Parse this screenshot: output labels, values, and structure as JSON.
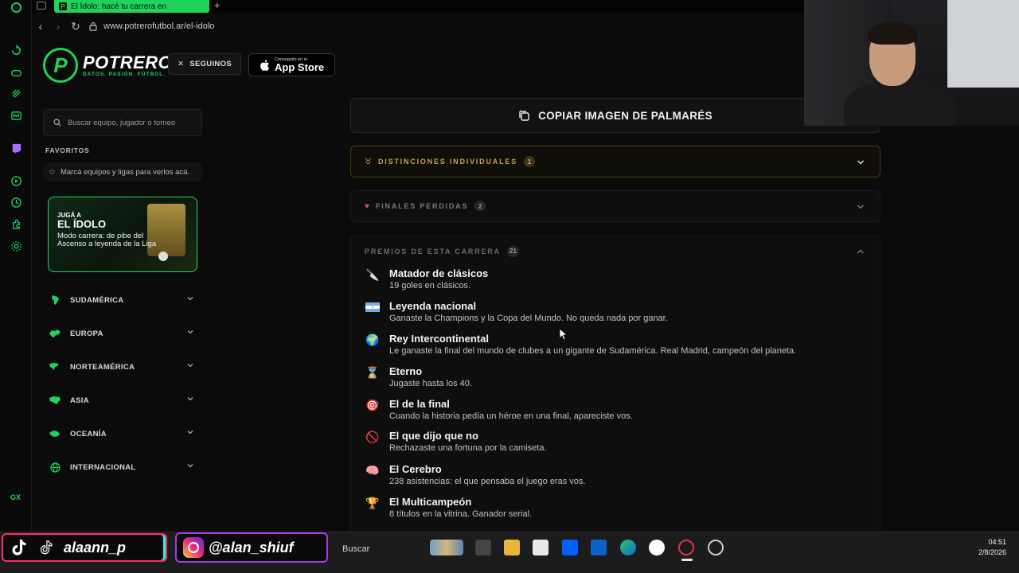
{
  "browser": {
    "tab_title": "El Ídolo: hacé tu carrera en",
    "tab_favicon": "P",
    "url": "www.potrerofutbol.ar/el-idolo",
    "new_tab_symbol": "+",
    "gx_label": "GX"
  },
  "header": {
    "logo_letter": "P",
    "logo_name": "POTRERO",
    "logo_tagline": "DATOS. PASIÓN. FÚTBOL.",
    "follow_label": "SEGUINOS",
    "appstore_line1": "Conseguilo en el",
    "appstore_line2": "App Store"
  },
  "sidebar": {
    "search_placeholder": "Buscar equipo, jugador o torneo",
    "favorites_title": "FAVORITOS",
    "favorites_empty": "Marcá equipos y ligas para verlos acá.",
    "promo": {
      "kicker": "JUGÁ A",
      "title": "EL ÍDOLO",
      "text": "Modo carrera: de pibe del Ascenso a leyenda de la Liga"
    },
    "regions": [
      {
        "label": "SUDAMÉRICA",
        "icon": "south-america-icon"
      },
      {
        "label": "EUROPA",
        "icon": "europe-icon"
      },
      {
        "label": "NORTEAMÉRICA",
        "icon": "north-america-icon"
      },
      {
        "label": "ASIA",
        "icon": "asia-icon"
      },
      {
        "label": "OCEANÍA",
        "icon": "oceania-icon"
      },
      {
        "label": "INTERNACIONAL",
        "icon": "globe-icon"
      }
    ]
  },
  "main": {
    "copy_button": "COPIAR IMAGEN DE PALMARÉS",
    "sections": {
      "distinciones": {
        "label": "DISTINCIONES INDIVIDUALES",
        "count": "1",
        "color": "#c9a24a"
      },
      "finales": {
        "label": "FINALES PERDIDAS",
        "count": "2"
      },
      "premios": {
        "label": "PREMIOS DE ESTA CARRERA",
        "count": "21"
      }
    },
    "awards": [
      {
        "icon": "knife-icon",
        "glyph": "🔪",
        "name": "Matador de clásicos",
        "desc": "19 goles en clásicos."
      },
      {
        "icon": "argentina-flag-icon",
        "glyph": "",
        "name": "Leyenda nacional",
        "desc": "Ganaste la Champions y la Copa del Mundo. No queda nada por ganar."
      },
      {
        "icon": "globe-icon",
        "glyph": "🌍",
        "name": "Rey Intercontinental",
        "desc": "Le ganaste la final del mundo de clubes a un gigante de Sudamérica. Real Madrid, campeón del planeta."
      },
      {
        "icon": "hourglass-icon",
        "glyph": "⌛",
        "name": "Eterno",
        "desc": "Jugaste hasta los 40."
      },
      {
        "icon": "target-icon",
        "glyph": "🎯",
        "name": "El de la final",
        "desc": "Cuando la historia pedía un héroe en una final, apareciste vos."
      },
      {
        "icon": "prohibited-icon",
        "glyph": "🚫",
        "name": "El que dijo que no",
        "desc": "Rechazaste una fortuna por la camiseta."
      },
      {
        "icon": "brain-icon",
        "glyph": "🧠",
        "name": "El Cerebro",
        "desc": "238 asistencias: el que pensaba el juego eras vos."
      },
      {
        "icon": "trophy-icon",
        "glyph": "🏆",
        "name": "El Multicampeón",
        "desc": "8 títulos en la vitrina. Ganador serial."
      }
    ]
  },
  "taskbar": {
    "tiktok_handle": "alaann_p",
    "instagram_handle": "@alan_shiuf",
    "search_label": "Buscar",
    "time": "04:51",
    "date": "2/8/2026"
  },
  "colors": {
    "accent": "#1fd35a",
    "gold": "#c9a24a",
    "background": "#0b0b0c"
  }
}
